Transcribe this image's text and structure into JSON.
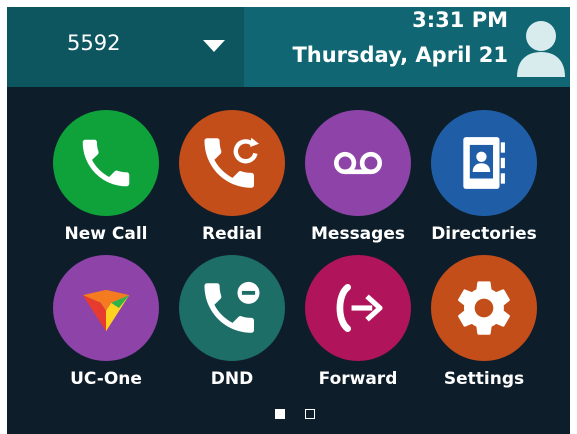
{
  "status_bar": {
    "line_number": "5592",
    "time": "3:31 PM",
    "date": "Thursday, April 21"
  },
  "apps": [
    {
      "label": "New Call",
      "icon": "phone-icon",
      "color": "#10a23a"
    },
    {
      "label": "Redial",
      "icon": "redial-icon",
      "color": "#c44e1a"
    },
    {
      "label": "Messages",
      "icon": "voicemail-icon",
      "color": "#8e43a8"
    },
    {
      "label": "Directories",
      "icon": "contacts-book-icon",
      "color": "#1f5ea6"
    },
    {
      "label": "UC-One",
      "icon": "uc-one-logo-icon",
      "color": "#8e43a8"
    },
    {
      "label": "DND",
      "icon": "dnd-phone-icon",
      "color": "#1e6e68"
    },
    {
      "label": "Forward",
      "icon": "forward-icon",
      "color": "#b0145a"
    },
    {
      "label": "Settings",
      "icon": "gear-icon",
      "color": "#c44e1a"
    }
  ],
  "pager": {
    "pages": 2,
    "current": 1
  }
}
